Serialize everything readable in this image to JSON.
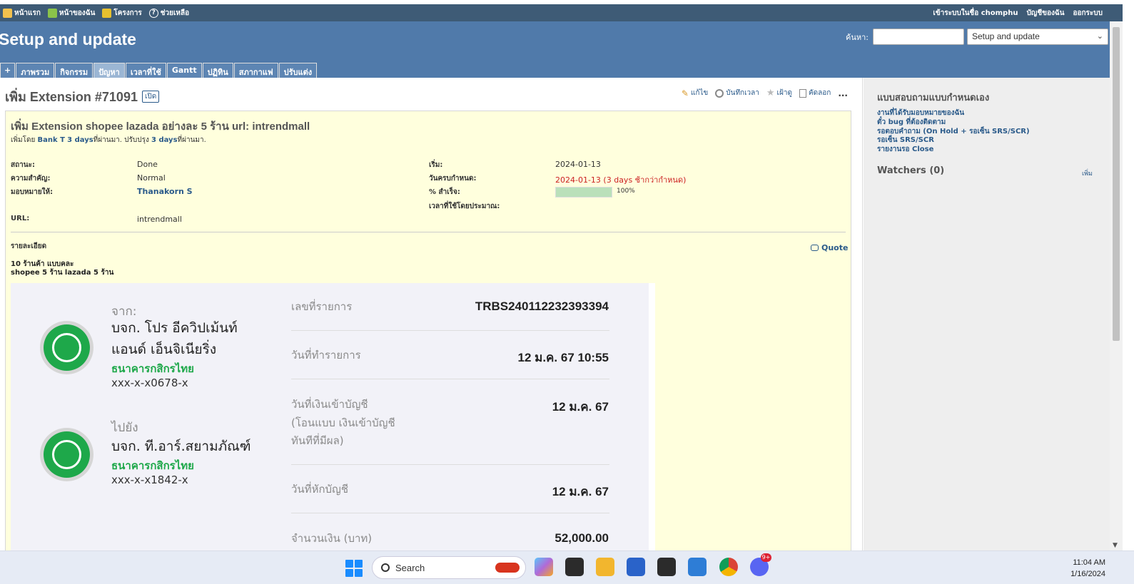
{
  "top_menu": {
    "home": "หน้าแรก",
    "my_page": "หน้าของฉัน",
    "projects": "โครงการ",
    "help": "ช่วยเหลือ",
    "logged_in_as": "เข้าระบบในชื่อ",
    "username": "chomphu",
    "my_account": "บัญชีของฉัน",
    "logout": "ออกระบบ"
  },
  "header": {
    "title": "Setup and update",
    "search_label": "ค้นหา:",
    "search_value": "",
    "project_select": "Setup and update"
  },
  "tabs": [
    {
      "label": "+"
    },
    {
      "label": "ภาพรวม"
    },
    {
      "label": "กิจกรรม"
    },
    {
      "label": "ปัญหา",
      "selected": true
    },
    {
      "label": "เวลาที่ใช้"
    },
    {
      "label": "Gantt"
    },
    {
      "label": "ปฏิทิน"
    },
    {
      "label": "สภากาแฟ"
    },
    {
      "label": "ปรับแต่ง"
    }
  ],
  "issue": {
    "heading": "เพิ่ม Extension #71091",
    "status_badge": "เปิด",
    "actions": {
      "edit": "แก้ไข",
      "log_time": "บันทึกเวลา",
      "watch": "เฝ้าดู",
      "copy": "คัดลอก",
      "more": "..."
    },
    "subject": "เพิ่ม Extension shopee lazada อย่างละ 5 ร้าน url: intrendmall",
    "author_prefix": "เพิ่มโดย",
    "author": "Bank T",
    "added_ago": "3 days",
    "ago_word": "ที่ผ่านมา.",
    "updated_prefix": "ปรับปรุง",
    "updated_ago": "3 days",
    "attributes": {
      "status_label": "สถานะ:",
      "status": "Done",
      "priority_label": "ความสำคัญ:",
      "priority": "Normal",
      "assignee_label": "มอบหมายให้:",
      "assignee": "Thanakorn S",
      "url_label": "URL:",
      "url": "intrendmall",
      "start_label": "เริ่ม:",
      "start": "2024-01-13",
      "due_label": "วันครบกำหนด:",
      "due": "2024-01-13 (3 days ช้ากว่ากำหนด)",
      "done_label": "% สำเร็จ:",
      "done_ratio": 1.0,
      "done_text": "100%",
      "estimated_label": "เวลาที่ใช้โดยประมาณ:",
      "estimated": ""
    },
    "description_label": "รายละเอียด",
    "quote": "Quote",
    "description_line1": "10 ร้านค้า แบบคละ",
    "description_line2": "shopee 5 ร้าน lazada 5 ร้าน"
  },
  "receipt": {
    "from_label": "จาก:",
    "from_name_line1": "บจก. โปร อีควิปเม้นท์",
    "from_name_line2": "แอนด์ เอ็นจิเนียริ่ง",
    "from_bank": "ธนาคารกสิกรไทย",
    "from_account": "xxx-x-x0678-x",
    "to_label": "ไปยัง",
    "to_name": "บจก. ที.อาร์.สยามภัณฑ์",
    "to_bank": "ธนาคารกสิกรไทย",
    "to_account": "xxx-x-x1842-x",
    "ref_label": "เลขที่รายการ",
    "ref_value": "TRBS240112232393394",
    "txn_date_label": "วันที่ทำรายการ",
    "txn_date_value": "12 ม.ค. 67 10:55",
    "credit_date_label_1": "วันที่เงินเข้าบัญชี",
    "credit_date_label_2": "(โอนแบบ เงินเข้าบัญชี",
    "credit_date_label_3": "ทันทีที่มีผล)",
    "credit_date_value": "12 ม.ค. 67",
    "debit_date_label": "วันที่หักบัญชี",
    "debit_date_value": "12 ม.ค. 67",
    "amount_label": "จำนวนเงิน (บาท)",
    "amount_value": "52,000.00"
  },
  "sidebar": {
    "title": "แบบสอบถามแบบกำหนดเอง",
    "links": [
      "งานที่ได้รับมอบหมายของฉัน",
      "ตั๋ว bug ที่ต้องติดตาม",
      "รอตอบคำถาม (On Hold + รอเซ็น SRS/SCR)",
      "รอเซ็น SRS/SCR",
      "รายงานรอ Close"
    ],
    "watchers": "Watchers (0)",
    "add_watcher": "เพิ่ม"
  },
  "taskbar": {
    "search": "Search",
    "time": "11:04 AM",
    "date": "1/16/2024",
    "discord_badge": "9+"
  },
  "colors": {
    "header_bg": "#507aaa",
    "top_bar_bg": "#3e5b76",
    "issue_bg": "#ffffdd",
    "kbank_green": "#1ea84a",
    "overdue_red": "#cc2222"
  }
}
